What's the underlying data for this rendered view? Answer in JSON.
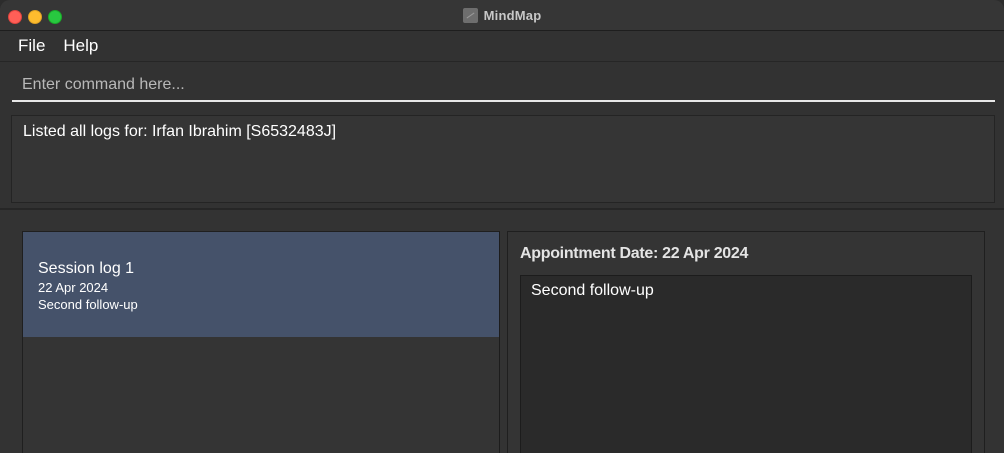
{
  "window": {
    "title": "MindMap",
    "controls": [
      "close",
      "minimize",
      "maximize"
    ]
  },
  "menu": {
    "items": [
      {
        "label": "File"
      },
      {
        "label": "Help"
      }
    ]
  },
  "command": {
    "placeholder": "Enter command here...",
    "value": ""
  },
  "result": {
    "message": "Listed all logs for: Irfan Ibrahim [S6532483J]"
  },
  "logs": [
    {
      "title": "Session log 1",
      "date": "22 Apr 2024",
      "description": "Second follow-up",
      "selected": true
    }
  ],
  "detail": {
    "heading": "Appointment Date: 22 Apr 2024",
    "notes": "Second follow-up"
  },
  "colors": {
    "selected_card": "#45526a",
    "background": "#323232",
    "close": "#ff5f57",
    "minimize": "#febc2e",
    "maximize": "#28c840"
  }
}
